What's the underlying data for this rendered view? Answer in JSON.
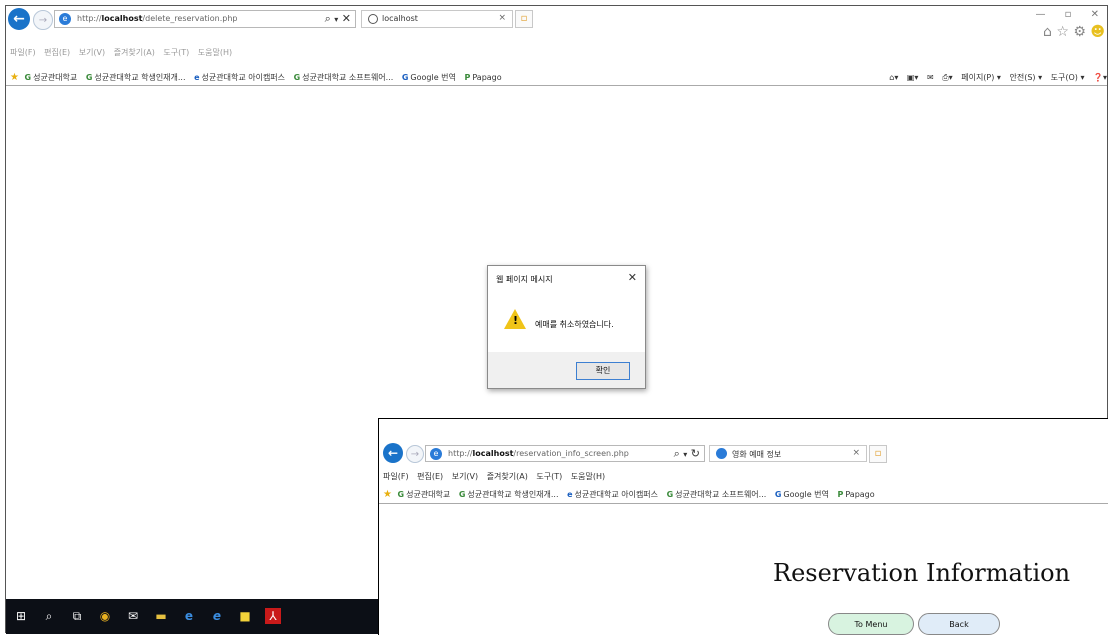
{
  "browser_main": {
    "url_prefix": "http://",
    "url_host": "localhost",
    "url_path": "/delete_reservation.php",
    "tab_title": "localhost",
    "menu": [
      "파일(F)",
      "편집(E)",
      "보기(V)",
      "즐겨찾기(A)",
      "도구(T)",
      "도움말(H)"
    ],
    "favorites": [
      "성균관대학교",
      "성균관대학교 학생인재개...",
      "성균관대학교 아이캠퍼스",
      "성균관대학교 소프트웨어...",
      "Google 번역",
      "Papago"
    ],
    "commands": [
      "페이지(P) ▾",
      "안전(S) ▾",
      "도구(O) ▾"
    ]
  },
  "dialog": {
    "title": "웹 페이지 메시지",
    "message": "예매를 취소하였습니다.",
    "ok_label": "확인"
  },
  "browser_second": {
    "url_prefix": "http://",
    "url_host": "localhost",
    "url_path": "/reservation_info_screen.php",
    "tab_title": "영화 예매 정보",
    "menu": [
      "파일(F)",
      "편집(E)",
      "보기(V)",
      "즐겨찾기(A)",
      "도구(T)",
      "도움말(H)"
    ],
    "favorites": [
      "성균관대학교",
      "성균관대학교 학생인재개...",
      "성균관대학교 아이캠퍼스",
      "성균관대학교 소프트웨어...",
      "Google 번역",
      "Papago"
    ]
  },
  "page": {
    "heading": "Reservation Information",
    "to_menu_label": "To Menu",
    "back_label": "Back"
  },
  "taskbar": {
    "icons": [
      "windows-start-icon",
      "search-icon",
      "task-view-icon",
      "chrome-icon",
      "mail-icon",
      "file-explorer-icon",
      "edge-icon",
      "internet-explorer-icon",
      "sticky-notes-icon",
      "acrobat-icon"
    ]
  }
}
